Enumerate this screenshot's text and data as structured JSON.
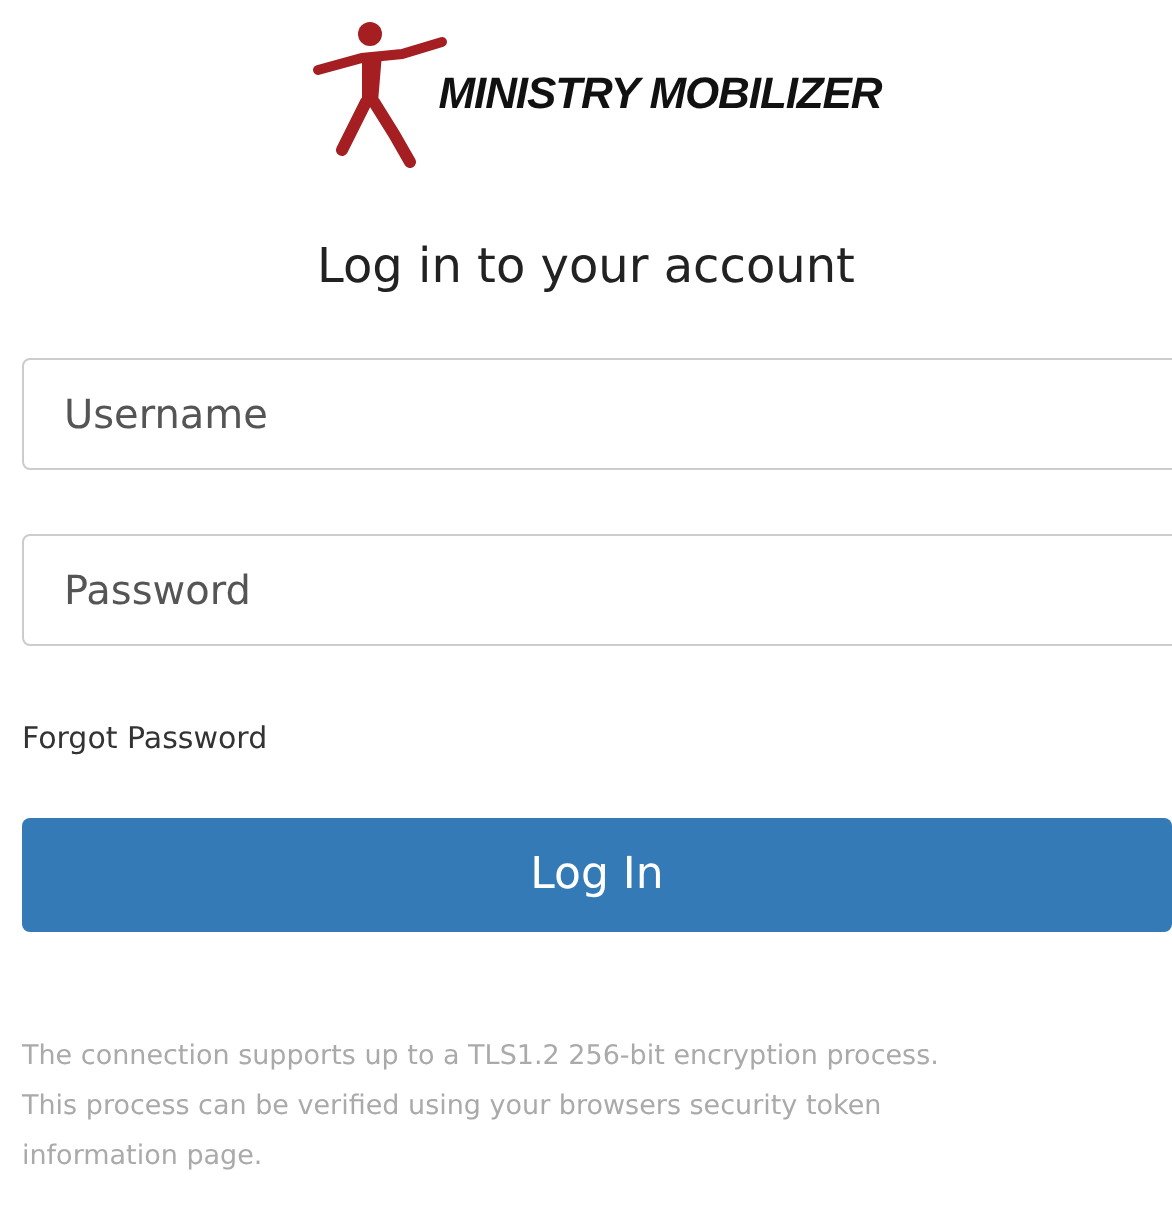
{
  "logo": {
    "text": "MINISTRY MOBILIZER"
  },
  "heading": "Log in to your account",
  "fields": [
    {
      "placeholder": "Username"
    },
    {
      "placeholder": "Password"
    }
  ],
  "forgot_link": "Forgot Password",
  "login_button": "Log In",
  "notice_lines": [
    "The connection supports up to a TLS1.2 256-bit encryption process.",
    "This process can be verified using your browsers security token",
    "information page."
  ]
}
